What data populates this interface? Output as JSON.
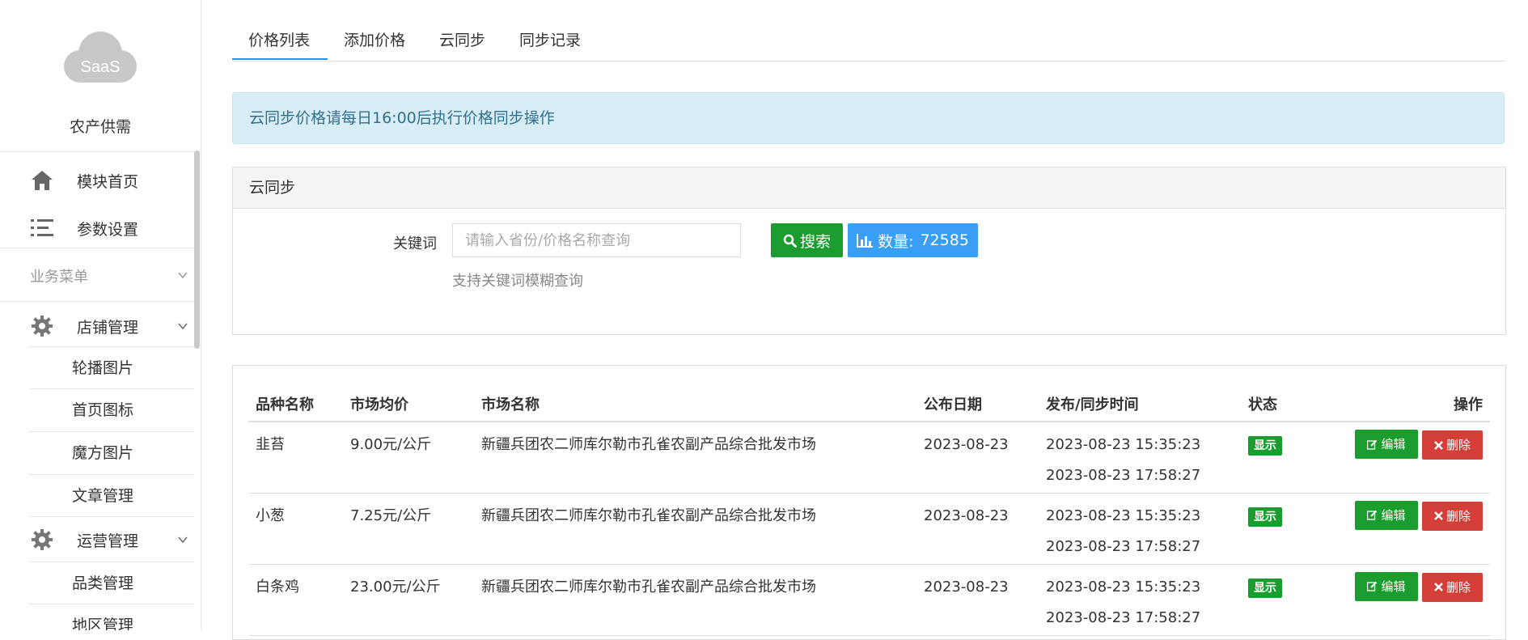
{
  "sidebar": {
    "logo_text": "SaaS",
    "app_name": "农产供需",
    "items": [
      {
        "label": "模块首页",
        "icon": "home-icon"
      },
      {
        "label": "参数设置",
        "icon": "settings-list-icon"
      }
    ],
    "group_label": "业务菜单",
    "menus": [
      {
        "label": "店铺管理",
        "icon": "gear-icon",
        "subs": [
          "轮播图片",
          "首页图标",
          "魔方图片",
          "文章管理"
        ]
      },
      {
        "label": "运营管理",
        "icon": "gear-icon",
        "subs": [
          "品类管理",
          "地区管理"
        ]
      }
    ]
  },
  "tabs": [
    "价格列表",
    "添加价格",
    "云同步",
    "同步记录"
  ],
  "alert_text": "云同步价格请每日16:00后执行价格同步操作",
  "search_panel": {
    "title": "云同步",
    "keyword_label": "关键词",
    "keyword_placeholder": "请输入省份/价格名称查询",
    "keyword_help": "支持关键词模糊查询",
    "search_button": "搜索",
    "count_label": "数量:",
    "count_value": "72585"
  },
  "table": {
    "columns": [
      "品种名称",
      "市场均价",
      "市场名称",
      "公布日期",
      "发布/同步时间",
      "状态",
      "操作"
    ],
    "rows": [
      {
        "name": "韭苔",
        "price": "9.00元/公斤",
        "market": "新疆兵团农二师库尔勒市孔雀农副产品综合批发市场",
        "date": "2023-08-23",
        "publish_time": "2023-08-23 15:35:23",
        "sync_time": "2023-08-23 17:58:27",
        "status": "显示"
      },
      {
        "name": "小葱",
        "price": "7.25元/公斤",
        "market": "新疆兵团农二师库尔勒市孔雀农副产品综合批发市场",
        "date": "2023-08-23",
        "publish_time": "2023-08-23 15:35:23",
        "sync_time": "2023-08-23 17:58:27",
        "status": "显示"
      },
      {
        "name": "白条鸡",
        "price": "23.00元/公斤",
        "market": "新疆兵团农二师库尔勒市孔雀农副产品综合批发市场",
        "date": "2023-08-23",
        "publish_time": "2023-08-23 15:35:23",
        "sync_time": "2023-08-23 17:58:27",
        "status": "显示"
      }
    ],
    "edit_label": "编辑",
    "delete_label": "删除"
  },
  "colors": {
    "green": "#1a9d2e",
    "blue": "#399ef5",
    "red": "#d43f3a",
    "tab_active": "#2f8cd7"
  }
}
